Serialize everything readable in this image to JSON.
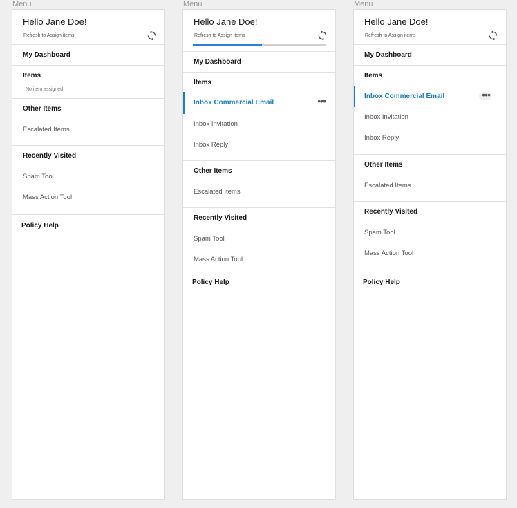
{
  "frame_label": "Menu",
  "greeting": "Hello Jane Doe!",
  "refresh_label": "Refresh to Assign items",
  "progress": 0.52,
  "sections": {
    "dashboard": "My Dashboard",
    "items": "Items",
    "no_items": "No item assigned",
    "other_items": "Other Items",
    "escalated": "Escalated Items",
    "recently_visited": "Recently Visited",
    "spam_tool": "Spam Tool",
    "mass_action_tool": "Mass Action Tool",
    "policy_help": "Policy Help"
  },
  "assigned_items": [
    "Inbox Commercial Email",
    "Inbox Invitation",
    "Inbox Reply"
  ],
  "more_label": "•••",
  "colors": {
    "accent": "#1d7fb5",
    "progress": "#2a7fd6",
    "background": "#efefef"
  }
}
